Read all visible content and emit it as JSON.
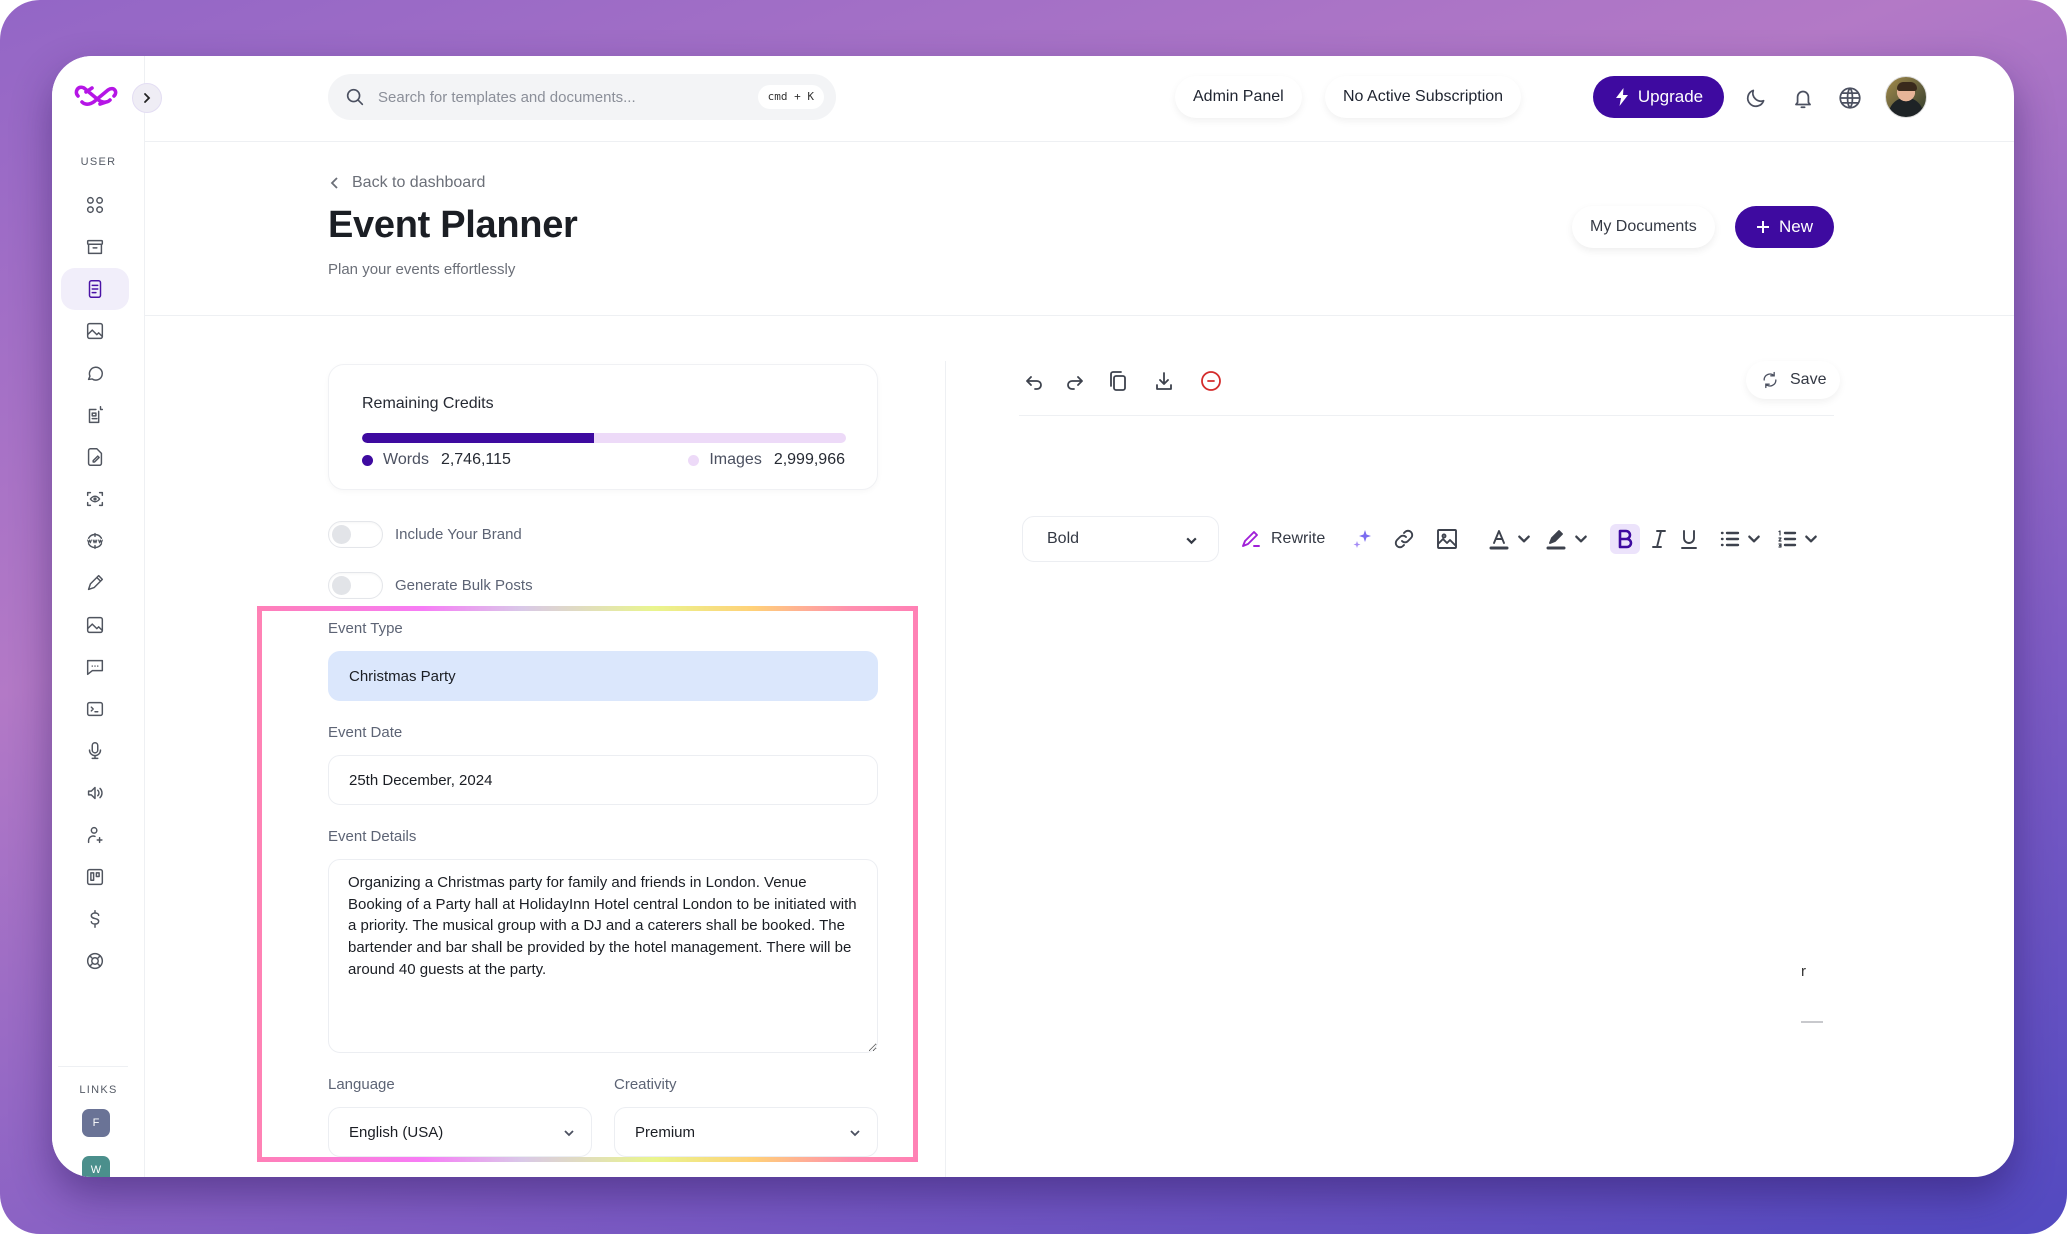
{
  "app": {
    "brand_color": "#3e0aa0",
    "logo_color": "#b515e6"
  },
  "sidebar": {
    "user_heading": "USER",
    "links_heading": "LINKS",
    "items": [
      {
        "name": "dashboard",
        "icon": "grid-icon",
        "active": false
      },
      {
        "name": "archive",
        "icon": "archive-icon",
        "active": false
      },
      {
        "name": "documents",
        "icon": "document-icon",
        "active": true
      },
      {
        "name": "ai-image",
        "icon": "image-icon",
        "active": false
      },
      {
        "name": "chat",
        "icon": "chat-bubble-icon",
        "active": false
      },
      {
        "name": "article",
        "icon": "article-spark-icon",
        "active": false
      },
      {
        "name": "file-edit",
        "icon": "file-edit-icon",
        "active": false
      },
      {
        "name": "vision",
        "icon": "scan-eye-icon",
        "active": false
      },
      {
        "name": "web",
        "icon": "www-globe-icon",
        "active": false
      },
      {
        "name": "rewriter",
        "icon": "pen-icon",
        "active": false
      },
      {
        "name": "image-gallery",
        "icon": "image-icon",
        "active": false
      },
      {
        "name": "chat-templates",
        "icon": "message-dots-icon",
        "active": false
      },
      {
        "name": "code",
        "icon": "terminal-icon",
        "active": false
      },
      {
        "name": "speech-to-text",
        "icon": "microphone-icon",
        "active": false
      },
      {
        "name": "voiceover",
        "icon": "speaker-icon",
        "active": false
      },
      {
        "name": "affiliate",
        "icon": "user-plus-icon",
        "active": false
      },
      {
        "name": "kanban",
        "icon": "kanban-icon",
        "active": false
      },
      {
        "name": "pricing",
        "icon": "dollar-icon",
        "active": false
      },
      {
        "name": "support",
        "icon": "lifebuoy-icon",
        "active": false
      }
    ],
    "links": [
      {
        "letter": "F",
        "color": "#6a7396"
      },
      {
        "letter": "W",
        "color": "#4b8f8c"
      }
    ]
  },
  "header": {
    "search_placeholder": "Search for templates and documents...",
    "search_shortcut": "cmd + K",
    "admin_panel": "Admin Panel",
    "subscription": "No Active Subscription",
    "upgrade": "Upgrade"
  },
  "page": {
    "back_link": "Back to dashboard",
    "title": "Event Planner",
    "subtitle": "Plan your events effortlessly",
    "my_documents": "My Documents",
    "new_button": "New"
  },
  "credits": {
    "title": "Remaining Credits",
    "words_label": "Words",
    "words_value": "2,746,115",
    "images_label": "Images",
    "images_value": "2,999,966",
    "words_share_percent": 48,
    "words_color": "#3e0aa0",
    "images_color": "#eddaf8"
  },
  "toggles": {
    "include_brand": {
      "label": "Include Your Brand",
      "on": false
    },
    "bulk_posts": {
      "label": "Generate Bulk Posts",
      "on": false
    }
  },
  "form": {
    "event_type_label": "Event Type",
    "event_type_value": "Christmas Party",
    "event_date_label": "Event Date",
    "event_date_value": "25th December, 2024",
    "event_details_label": "Event Details",
    "event_details_value": "Organizing a Christmas party for family and friends in London. Venue Booking of a Party hall at HolidayInn Hotel central London to be initiated with a priority. The musical group with a DJ and a caterers shall be booked. The bartender and bar shall be provided by the hotel management. There will be around 40 guests at the party.",
    "language_label": "Language",
    "language_value": "English (USA)",
    "creativity_label": "Creativity",
    "creativity_value": "Premium"
  },
  "editor": {
    "save_label": "Save",
    "style_select_value": "Bold",
    "rewrite_label": "Rewrite",
    "stray_char": "r"
  }
}
